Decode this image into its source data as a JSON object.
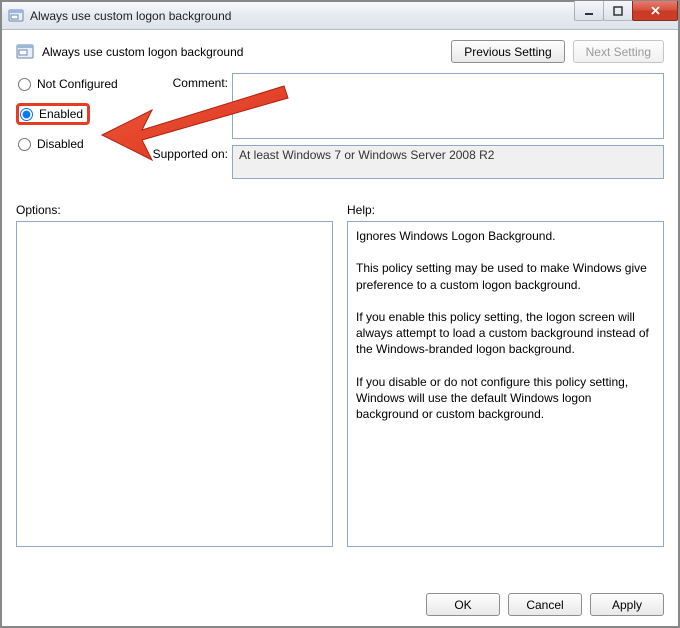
{
  "window": {
    "title": "Always use custom logon background"
  },
  "header": {
    "policy_title": "Always use custom logon background",
    "previous_label": "Previous Setting",
    "next_label": "Next Setting"
  },
  "state_options": {
    "not_configured": "Not Configured",
    "enabled": "Enabled",
    "disabled": "Disabled",
    "selected": "enabled"
  },
  "labels": {
    "comment": "Comment:",
    "supported_on": "Supported on:",
    "options": "Options:",
    "help": "Help:"
  },
  "fields": {
    "comment_value": "",
    "supported_text": "At least Windows 7 or Windows Server 2008 R2",
    "options_content": "",
    "help_content": "Ignores Windows Logon Background.\n\nThis policy setting may be used to make Windows give preference to a custom logon background.\n\nIf you enable this policy setting, the logon screen will always attempt to load a custom background instead of the Windows-branded logon background.\n\nIf you disable or do not configure this policy setting, Windows will use the default Windows logon background or custom background."
  },
  "buttons": {
    "ok": "OK",
    "cancel": "Cancel",
    "apply": "Apply"
  }
}
